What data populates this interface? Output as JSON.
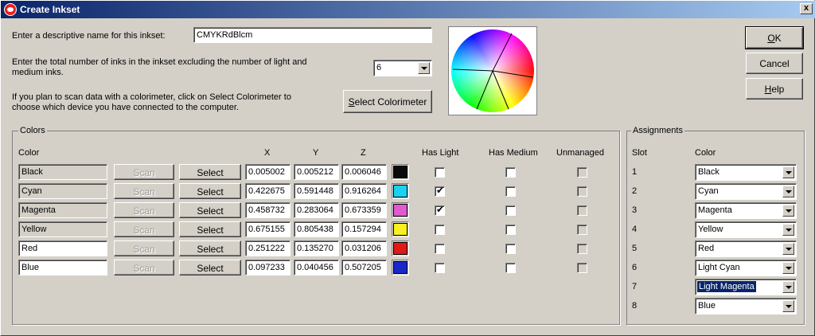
{
  "window": {
    "title": "Create Inkset",
    "close_label": "x"
  },
  "form": {
    "name_label": "Enter a descriptive name for this inkset:",
    "name_value": "CMYKRdBlcm",
    "inks_label_line1": "Enter the total number of inks in the inkset excluding the number of light and",
    "inks_label_line2": "medium inks.",
    "inks_value": "6",
    "scan_label_line1": "If you plan to scan data with a colorimeter, click on Select Colorimeter to",
    "scan_label_line2": "choose which device you have connected to the computer.",
    "select_colorimeter_pre": "",
    "select_colorimeter_accel": "S",
    "select_colorimeter_post": "elect Colorimeter"
  },
  "buttons": {
    "ok_accel": "O",
    "ok_rest": "K",
    "cancel": "Cancel",
    "help_accel": "H",
    "help_rest": "elp"
  },
  "colors": {
    "group_label": "Colors",
    "headers": {
      "color": "Color",
      "x": "X",
      "y": "Y",
      "z": "Z",
      "has_light": "Has Light",
      "has_medium": "Has Medium",
      "unmanaged": "Unmanaged"
    },
    "scan_label": "Scan",
    "select_label": "Select",
    "check_mark": "✔",
    "rows": [
      {
        "name": "Black",
        "readonly": true,
        "x": "0.005002",
        "y": "0.005212",
        "z": "0.006046",
        "swatch": "#0a0a0a",
        "has_light": false,
        "has_medium": false
      },
      {
        "name": "Cyan",
        "readonly": true,
        "x": "0.422675",
        "y": "0.591448",
        "z": "0.916264",
        "swatch": "#1ad2f0",
        "has_light": true,
        "has_medium": false
      },
      {
        "name": "Magenta",
        "readonly": true,
        "x": "0.458732",
        "y": "0.283064",
        "z": "0.673359",
        "swatch": "#e05ad0",
        "has_light": true,
        "has_medium": false
      },
      {
        "name": "Yellow",
        "readonly": true,
        "x": "0.675155",
        "y": "0.805438",
        "z": "0.157294",
        "swatch": "#f8f020",
        "has_light": false,
        "has_medium": false
      },
      {
        "name": "Red",
        "readonly": false,
        "x": "0.251222",
        "y": "0.135270",
        "z": "0.031206",
        "swatch": "#e01818",
        "has_light": false,
        "has_medium": false
      },
      {
        "name": "Blue",
        "readonly": false,
        "x": "0.097233",
        "y": "0.040456",
        "z": "0.507205",
        "swatch": "#1828c8",
        "has_light": false,
        "has_medium": false
      }
    ]
  },
  "assignments": {
    "group_label": "Assignments",
    "headers": {
      "slot": "Slot",
      "color": "Color"
    },
    "slots": [
      {
        "slot": "1",
        "color": "Black",
        "selected": false
      },
      {
        "slot": "2",
        "color": "Cyan",
        "selected": false
      },
      {
        "slot": "3",
        "color": "Magenta",
        "selected": false
      },
      {
        "slot": "4",
        "color": "Yellow",
        "selected": false
      },
      {
        "slot": "5",
        "color": "Red",
        "selected": false
      },
      {
        "slot": "6",
        "color": "Light Cyan",
        "selected": false
      },
      {
        "slot": "7",
        "color": "Light Magenta",
        "selected": true
      },
      {
        "slot": "8",
        "color": "Blue",
        "selected": false
      }
    ]
  }
}
